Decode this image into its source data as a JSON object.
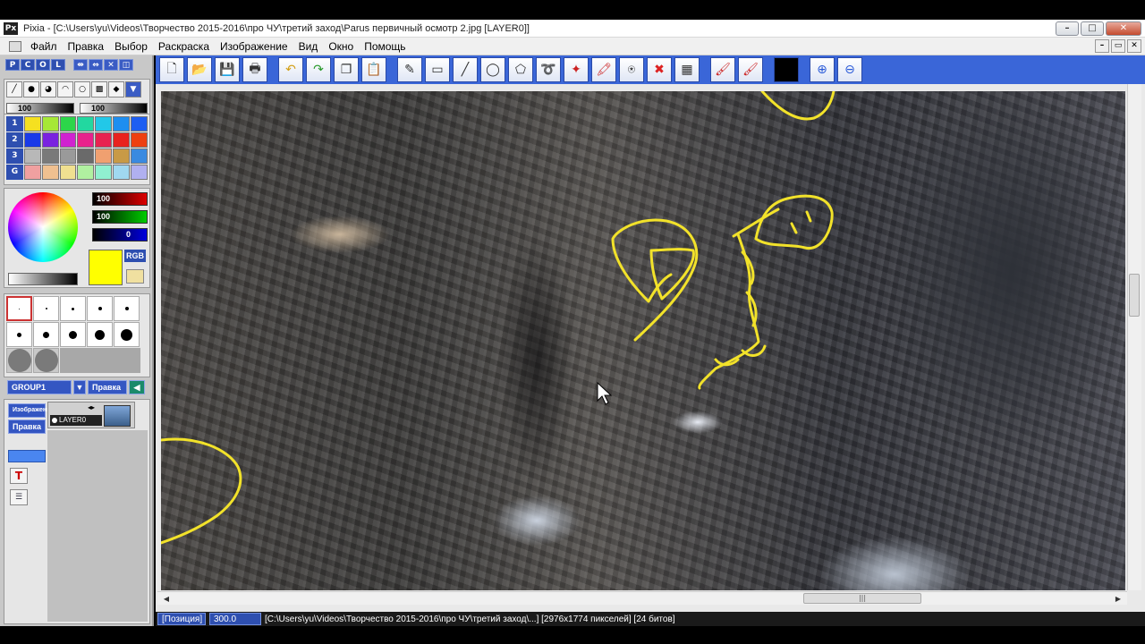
{
  "window": {
    "title": "Pixia - [C:\\Users\\yu\\Videos\\Творчество 2015-2016\\про ЧУ\\третий заход\\Parus первичный осмотр 2.jpg [LAYER0]]",
    "app_icon_text": "Px",
    "controls": {
      "minimize": "–",
      "maximize": "□",
      "close": "✕"
    },
    "mdi_controls": {
      "minimize": "–",
      "restore": "▭",
      "close": "✕"
    }
  },
  "menu": {
    "items": [
      "Файл",
      "Правка",
      "Выбор",
      "Раскраска",
      "Изображение",
      "Вид",
      "Окно",
      "Помощь"
    ]
  },
  "left_panel": {
    "mode_buttons": [
      "P",
      "C",
      "O",
      "L"
    ],
    "mini_tools": [
      "⇹",
      "⇔",
      "✕",
      "◫"
    ],
    "opacity_a": "100",
    "opacity_b": "100",
    "palette_labels": [
      "1",
      "2",
      "3",
      "G"
    ],
    "palette_colors": [
      [
        "#f5e020",
        "#a6e836",
        "#2cd64a",
        "#22d8a0",
        "#22c8e8",
        "#1e8ef0",
        "#1e5ef2"
      ],
      [
        "#1a3ae8",
        "#7a22e0",
        "#d022d0",
        "#e8228c",
        "#e82250",
        "#e8221e",
        "#ee4010"
      ],
      [
        "#b8b8b8",
        "#7a7a7a",
        "#9a9a9a",
        "#6a6a6a",
        "#f0a070",
        "#c89a46",
        "#3a8ae0"
      ],
      [
        "#f0a0a0",
        "#f0c090",
        "#f0e090",
        "#b0f0a0",
        "#90f0d0",
        "#a0d8f0",
        "#b0b0f0"
      ]
    ],
    "color": {
      "r": "100",
      "g": "100",
      "b": "0",
      "current_swatch": "#ffff00",
      "mode_label": "RGB"
    },
    "group_label": "GROUP1",
    "edit_label": "Правка",
    "layer_header": "Изображение",
    "layer_edit": "Правка",
    "layer_name": "LAYER0"
  },
  "toolbar": {
    "tools": [
      "new-file-icon",
      "open-folder-icon",
      "save-icon",
      "print-icon",
      "undo-icon",
      "redo-icon",
      "copy-icon",
      "paste-icon",
      "pen-icon",
      "rectangle-icon",
      "line-icon",
      "ellipse-icon",
      "fill-shape-icon",
      "lasso-icon",
      "magic-wand-icon",
      "color-pick-icon",
      "stamp-icon",
      "delete-selection-icon",
      "transparency-icon",
      "brush-red-icon",
      "brush-red-alt-icon",
      "foreground-color-icon",
      "zoom-in-icon",
      "zoom-out-icon"
    ]
  },
  "statusbar": {
    "position_label": "[Позиция]",
    "zoom_value": "300.0",
    "file_info": "[C:\\Users\\yu\\Videos\\Творчество 2015-2016\\про ЧУ\\третий заход\\...] [2976x1774 пикселей] [24 битов]"
  },
  "scroll": {
    "hthumb_grip": "|||"
  },
  "colors": {
    "toolbar_blue": "#3a66d8",
    "panel_gray": "#c8c8c8",
    "annotation_yellow": "#f2e22a"
  }
}
